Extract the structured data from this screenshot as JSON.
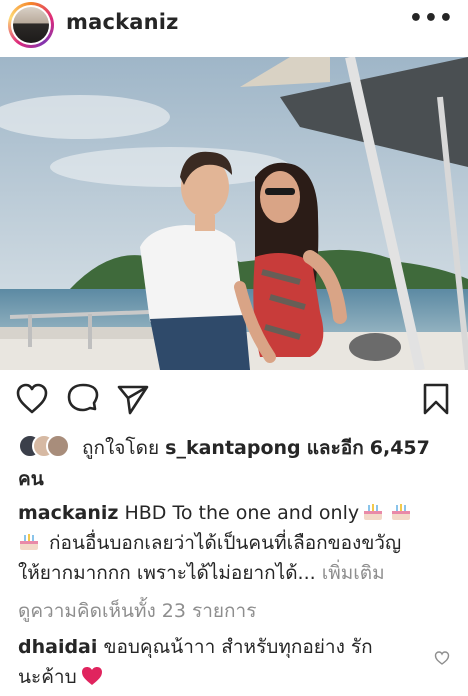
{
  "post": {
    "username": "mackaniz",
    "more_label": "•••"
  },
  "likes": {
    "prefix": "ถูกใจโดย",
    "user": "s_kantapong",
    "middle": "และอีก",
    "count": "6,457",
    "suffix": "คน"
  },
  "caption": {
    "author": "mackaniz",
    "line1": "HBD To the one and only",
    "line2": "ก่อนอื่นบอกเลยว่าได้เป็นคนที่เลือกของขวัญ",
    "line3": "ให้ยากมากกก เพราะได้ไม่อยากได้...",
    "more": "เพิ่มเติม"
  },
  "view_comments": "ดูความคิดเห็นทั้ง 23 รายการ",
  "comment": {
    "author": "dhaidai",
    "text1": "ขอบคุณน้าาา สำหรับทุกอย่าง รัก",
    "text2": "นะค้าบ"
  },
  "icons": {
    "like": "heart-outline-icon",
    "comment": "comment-bubble-icon",
    "share": "paper-plane-icon",
    "save": "bookmark-icon",
    "cake": "birthday-cake-emoji",
    "heart": "red-heart-emoji"
  },
  "colors": {
    "text": "#262626",
    "muted": "#8e8e8e",
    "emoji_heart": "#e0245e"
  }
}
